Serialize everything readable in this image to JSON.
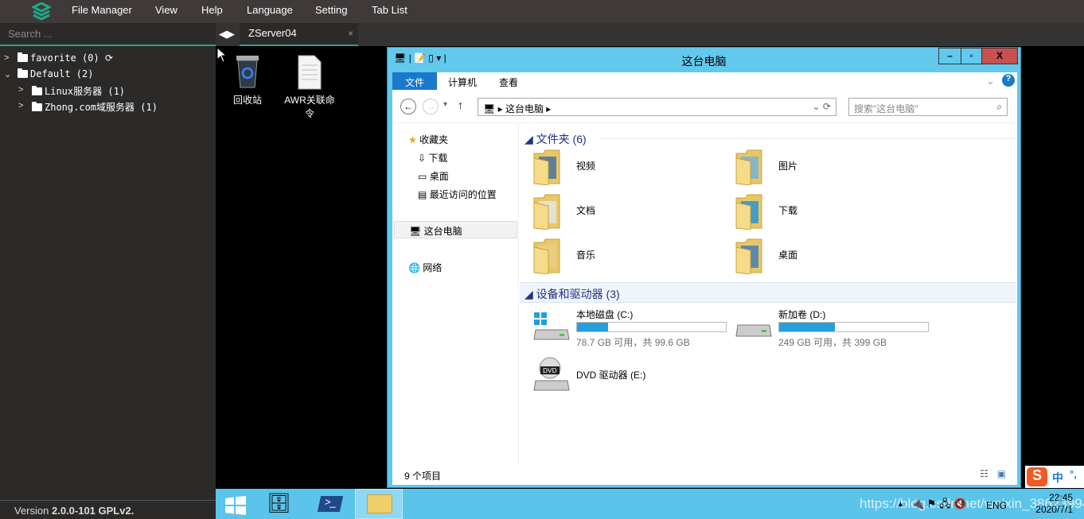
{
  "menu": [
    "File Manager",
    "View",
    "Help",
    "Language",
    "Setting",
    "Tab List"
  ],
  "sidebar": {
    "search_placeholder": "Search ...",
    "tree": [
      {
        "label": "favorite (0)",
        "expanded": false
      },
      {
        "label": "Default (2)",
        "expanded": true
      },
      {
        "label": "Linux服务器 (1)",
        "expanded": false
      },
      {
        "label": "Zhong.com域服务器 (1)",
        "expanded": false
      }
    ],
    "version_prefix": "Version ",
    "version": "2.0.0-101 GPLv2."
  },
  "tab": {
    "label": "ZServer04",
    "close": "×"
  },
  "desktop": [
    "回收站",
    "AWR关联命令"
  ],
  "explorer": {
    "title": "这台电脑",
    "ribbon_tabs": [
      "文件",
      "计算机",
      "查看"
    ],
    "breadcrumb": "这台电脑",
    "search_placeholder": "搜索\"这台电脑\"",
    "nav": [
      "收藏夹",
      "下载",
      "桌面",
      "最近访问的位置",
      "这台电脑",
      "网络"
    ],
    "folders_header": "文件夹 (6)",
    "folders": [
      "视频",
      "图片",
      "文档",
      "下载",
      "音乐",
      "桌面"
    ],
    "devices_header": "设备和驱动器 (3)",
    "drives": [
      {
        "name": "本地磁盘 (C:)",
        "info": "78.7 GB 可用，共 99.6 GB",
        "used_percent": 21
      },
      {
        "name": "新加卷 (D:)",
        "info": "249 GB 可用，共 399 GB",
        "used_percent": 37.6
      },
      {
        "name": "DVD 驱动器 (E:)"
      }
    ],
    "status": "9 个项目",
    "accent": "#1979ca"
  },
  "ime": "中",
  "taskbar": {
    "lang": "ENG",
    "time": "22:45",
    "date": "2020/7/1",
    "watermark": "https://blog.csdn.net/weixin_38623994"
  }
}
